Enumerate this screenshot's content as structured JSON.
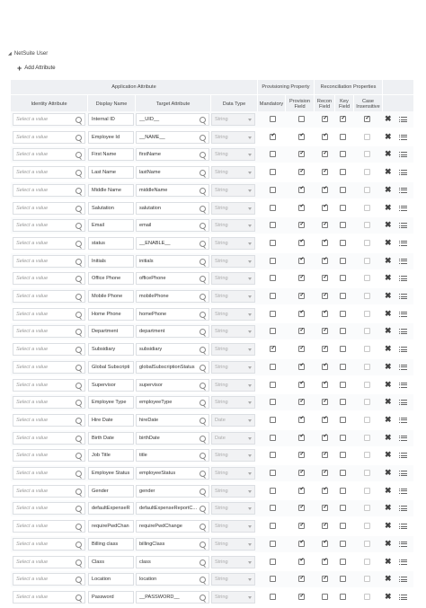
{
  "section": {
    "title": "NetSuite User",
    "add_label": "Add Attribute"
  },
  "headers": {
    "app_attr": "Application Attribute",
    "prov_prop": "Provisioning Property",
    "recon_prop": "Reconciliation Properties",
    "identity_attr": "Identity Attribute",
    "display_name": "Display Name",
    "target_attr": "Target Attribute",
    "data_type": "Data Type",
    "mandatory": "Mandatory",
    "provision_field": "Provision Field",
    "recon_field": "Recon Field",
    "key_field": "Key Field",
    "case_insensitive": "Case Insensitive"
  },
  "placeholder": "Select a value",
  "rows": [
    {
      "display": "Internal ID",
      "target": "__UID__",
      "type": "String",
      "mandatory": false,
      "provision": false,
      "recon": true,
      "key": true,
      "ci": true
    },
    {
      "display": "Employee Id",
      "target": "__NAME__",
      "type": "String",
      "mandatory": true,
      "provision": true,
      "recon": true,
      "key": false,
      "ci": false
    },
    {
      "display": "First Name",
      "target": "firstName",
      "type": "String",
      "mandatory": false,
      "provision": true,
      "recon": true,
      "key": false,
      "ci": false
    },
    {
      "display": "Last Name",
      "target": "lastName",
      "type": "String",
      "mandatory": false,
      "provision": true,
      "recon": true,
      "key": false,
      "ci": false
    },
    {
      "display": "Middle Name",
      "target": "middleName",
      "type": "String",
      "mandatory": false,
      "provision": true,
      "recon": true,
      "key": false,
      "ci": false
    },
    {
      "display": "Salutation",
      "target": "salutation",
      "type": "String",
      "mandatory": false,
      "provision": true,
      "recon": true,
      "key": false,
      "ci": false
    },
    {
      "display": "Email",
      "target": "email",
      "type": "String",
      "mandatory": false,
      "provision": true,
      "recon": true,
      "key": false,
      "ci": false
    },
    {
      "display": "status",
      "target": "__ENABLE__",
      "type": "String",
      "mandatory": false,
      "provision": true,
      "recon": true,
      "key": false,
      "ci": false
    },
    {
      "display": "Initials",
      "target": "initials",
      "type": "String",
      "mandatory": false,
      "provision": true,
      "recon": true,
      "key": false,
      "ci": false
    },
    {
      "display": "Office Phone",
      "target": "officePhone",
      "type": "String",
      "mandatory": false,
      "provision": true,
      "recon": true,
      "key": false,
      "ci": false
    },
    {
      "display": "Mobile Phone",
      "target": "mobilePhone",
      "type": "String",
      "mandatory": false,
      "provision": true,
      "recon": true,
      "key": false,
      "ci": false
    },
    {
      "display": "Home Phone",
      "target": "homePhone",
      "type": "String",
      "mandatory": false,
      "provision": true,
      "recon": true,
      "key": false,
      "ci": false
    },
    {
      "display": "Department",
      "target": "department",
      "type": "String",
      "mandatory": false,
      "provision": true,
      "recon": true,
      "key": false,
      "ci": false
    },
    {
      "display": "Subsidiary",
      "target": "subsidiary",
      "type": "String",
      "mandatory": true,
      "provision": true,
      "recon": true,
      "key": false,
      "ci": false
    },
    {
      "display": "Global Subscripti",
      "target": "globalSubscriptionStatus",
      "type": "String",
      "mandatory": false,
      "provision": true,
      "recon": true,
      "key": false,
      "ci": false
    },
    {
      "display": "Supervisor",
      "target": "supervisor",
      "type": "String",
      "mandatory": false,
      "provision": true,
      "recon": true,
      "key": false,
      "ci": false
    },
    {
      "display": "Employee Type",
      "target": "employeeType",
      "type": "String",
      "mandatory": false,
      "provision": true,
      "recon": true,
      "key": false,
      "ci": false
    },
    {
      "display": "Hire Date",
      "target": "hireDate",
      "type": "Date",
      "mandatory": false,
      "provision": true,
      "recon": true,
      "key": false,
      "ci": false
    },
    {
      "display": "Birth Date",
      "target": "birthDate",
      "type": "Date",
      "mandatory": false,
      "provision": true,
      "recon": true,
      "key": false,
      "ci": false
    },
    {
      "display": "Job Title",
      "target": "title",
      "type": "String",
      "mandatory": false,
      "provision": true,
      "recon": true,
      "key": false,
      "ci": false
    },
    {
      "display": "Employee Status",
      "target": "employeeStatus",
      "type": "String",
      "mandatory": false,
      "provision": true,
      "recon": true,
      "key": false,
      "ci": false
    },
    {
      "display": "Gender",
      "target": "gender",
      "type": "String",
      "mandatory": false,
      "provision": true,
      "recon": true,
      "key": false,
      "ci": false
    },
    {
      "display": "defaultExpenseR",
      "target": "defaultExpenseReportC...",
      "type": "String",
      "mandatory": false,
      "provision": true,
      "recon": true,
      "key": false,
      "ci": false
    },
    {
      "display": "requirePwdChan",
      "target": "requirePwdChange",
      "type": "String",
      "mandatory": false,
      "provision": true,
      "recon": true,
      "key": false,
      "ci": false
    },
    {
      "display": "Billing class",
      "target": "billingClass",
      "type": "String",
      "mandatory": false,
      "provision": true,
      "recon": true,
      "key": false,
      "ci": false
    },
    {
      "display": "Class",
      "target": "class",
      "type": "String",
      "mandatory": false,
      "provision": true,
      "recon": true,
      "key": false,
      "ci": false
    },
    {
      "display": "Location",
      "target": "location",
      "type": "String",
      "mandatory": false,
      "provision": true,
      "recon": true,
      "key": false,
      "ci": false
    },
    {
      "display": "Password",
      "target": "__PASSWORD__",
      "type": "String",
      "mandatory": false,
      "provision": true,
      "recon": false,
      "key": false,
      "ci": false
    }
  ]
}
